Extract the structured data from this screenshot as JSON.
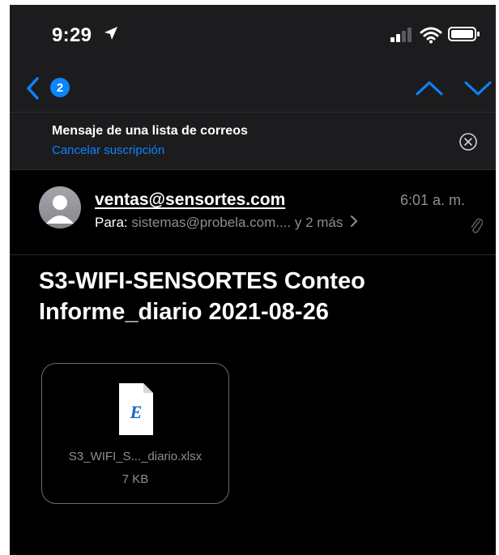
{
  "status_bar": {
    "time": "9:29",
    "icons": [
      "location-arrow-icon",
      "cellular-signal-icon",
      "wifi-icon",
      "battery-icon"
    ]
  },
  "nav": {
    "back_badge": "2",
    "icons": [
      "back-chevron-icon",
      "chevron-up-icon",
      "chevron-down-icon"
    ]
  },
  "mailing_list": {
    "title": "Mensaje de una lista de correos",
    "unsubscribe": "Cancelar suscripción"
  },
  "email": {
    "sender": "ventas@sensortes.com",
    "time": "6:01 a. m.",
    "to_label": "Para:",
    "to_value": "sistemas@probela.com.... y 2 más",
    "subject": "S3-WIFI-SENSORTES Conteo Informe_diario 2021-08-26"
  },
  "attachment": {
    "icon_letter": "E",
    "file_name": "S3_WIFI_S..._diario.xlsx",
    "file_size": "7 KB"
  },
  "colors": {
    "background": "#000000",
    "bar_background": "#1c1c1e",
    "accent": "#0a84ff",
    "secondary_text": "#8e8e93"
  }
}
